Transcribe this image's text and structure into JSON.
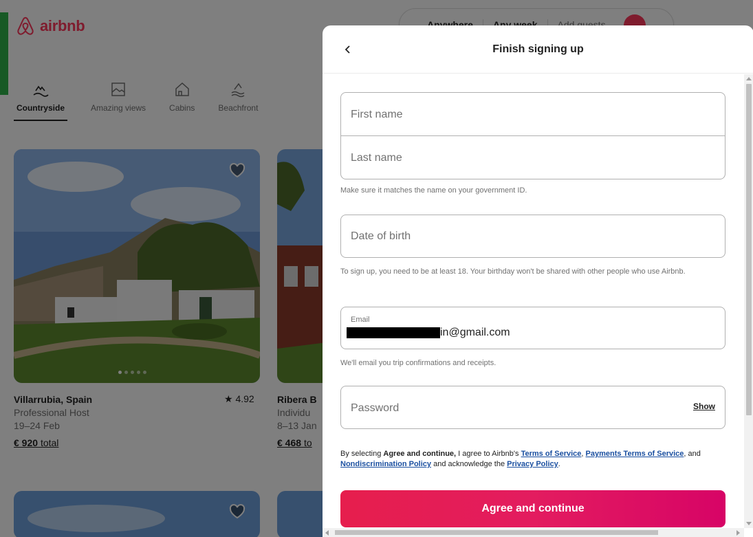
{
  "brand": {
    "name": "airbnb",
    "color": "#ff385c"
  },
  "search": {
    "where": "Anywhere",
    "when": "Any week",
    "guests": "Add guests"
  },
  "categories": [
    {
      "label": "Countryside",
      "icon": "countryside-icon",
      "active": true
    },
    {
      "label": "Amazing views",
      "icon": "amazing-views-icon",
      "active": false
    },
    {
      "label": "Cabins",
      "icon": "cabin-icon",
      "active": false
    },
    {
      "label": "Beachfront",
      "icon": "beachfront-icon",
      "active": false
    }
  ],
  "listings": [
    {
      "title": "Villarrubia, Spain",
      "host": "Professional Host",
      "dates": "19–24 Feb",
      "price": "€ 920",
      "price_suffix": "total",
      "rating": "★ 4.92"
    },
    {
      "title": "Ribera B",
      "host": "Individu",
      "dates": "8–13 Jan",
      "price": "€ 468",
      "price_suffix": "to"
    }
  ],
  "modal": {
    "title": "Finish signing up",
    "first_name_placeholder": "First name",
    "last_name_placeholder": "Last name",
    "name_hint": "Make sure it matches the name on your government ID.",
    "dob_placeholder": "Date of birth",
    "dob_hint": "To sign up, you need to be at least 18. Your birthday won't be shared with other people who use Airbnb.",
    "email_label": "Email",
    "email_value_visible": "in@gmail.com",
    "email_hint": "We'll email you trip confirmations and receipts.",
    "password_placeholder": "Password",
    "show_label": "Show",
    "legal": {
      "prefix": "By selecting ",
      "bold": "Agree and continue,",
      "mid1": " I agree to Airbnb's ",
      "terms": "Terms of Service",
      "comma": ", ",
      "payments": "Payments Terms of Service",
      "mid2": ", and ",
      "nondisc": "Nondiscrimination Policy",
      "mid3": " and acknowledge the ",
      "privacy": "Privacy Policy",
      "end": "."
    },
    "agree_button": "Agree and continue"
  },
  "colors": {
    "accent": "#e31c5f",
    "link": "#1a4fa0",
    "overlay": "rgba(0,0,0,0.5)"
  }
}
